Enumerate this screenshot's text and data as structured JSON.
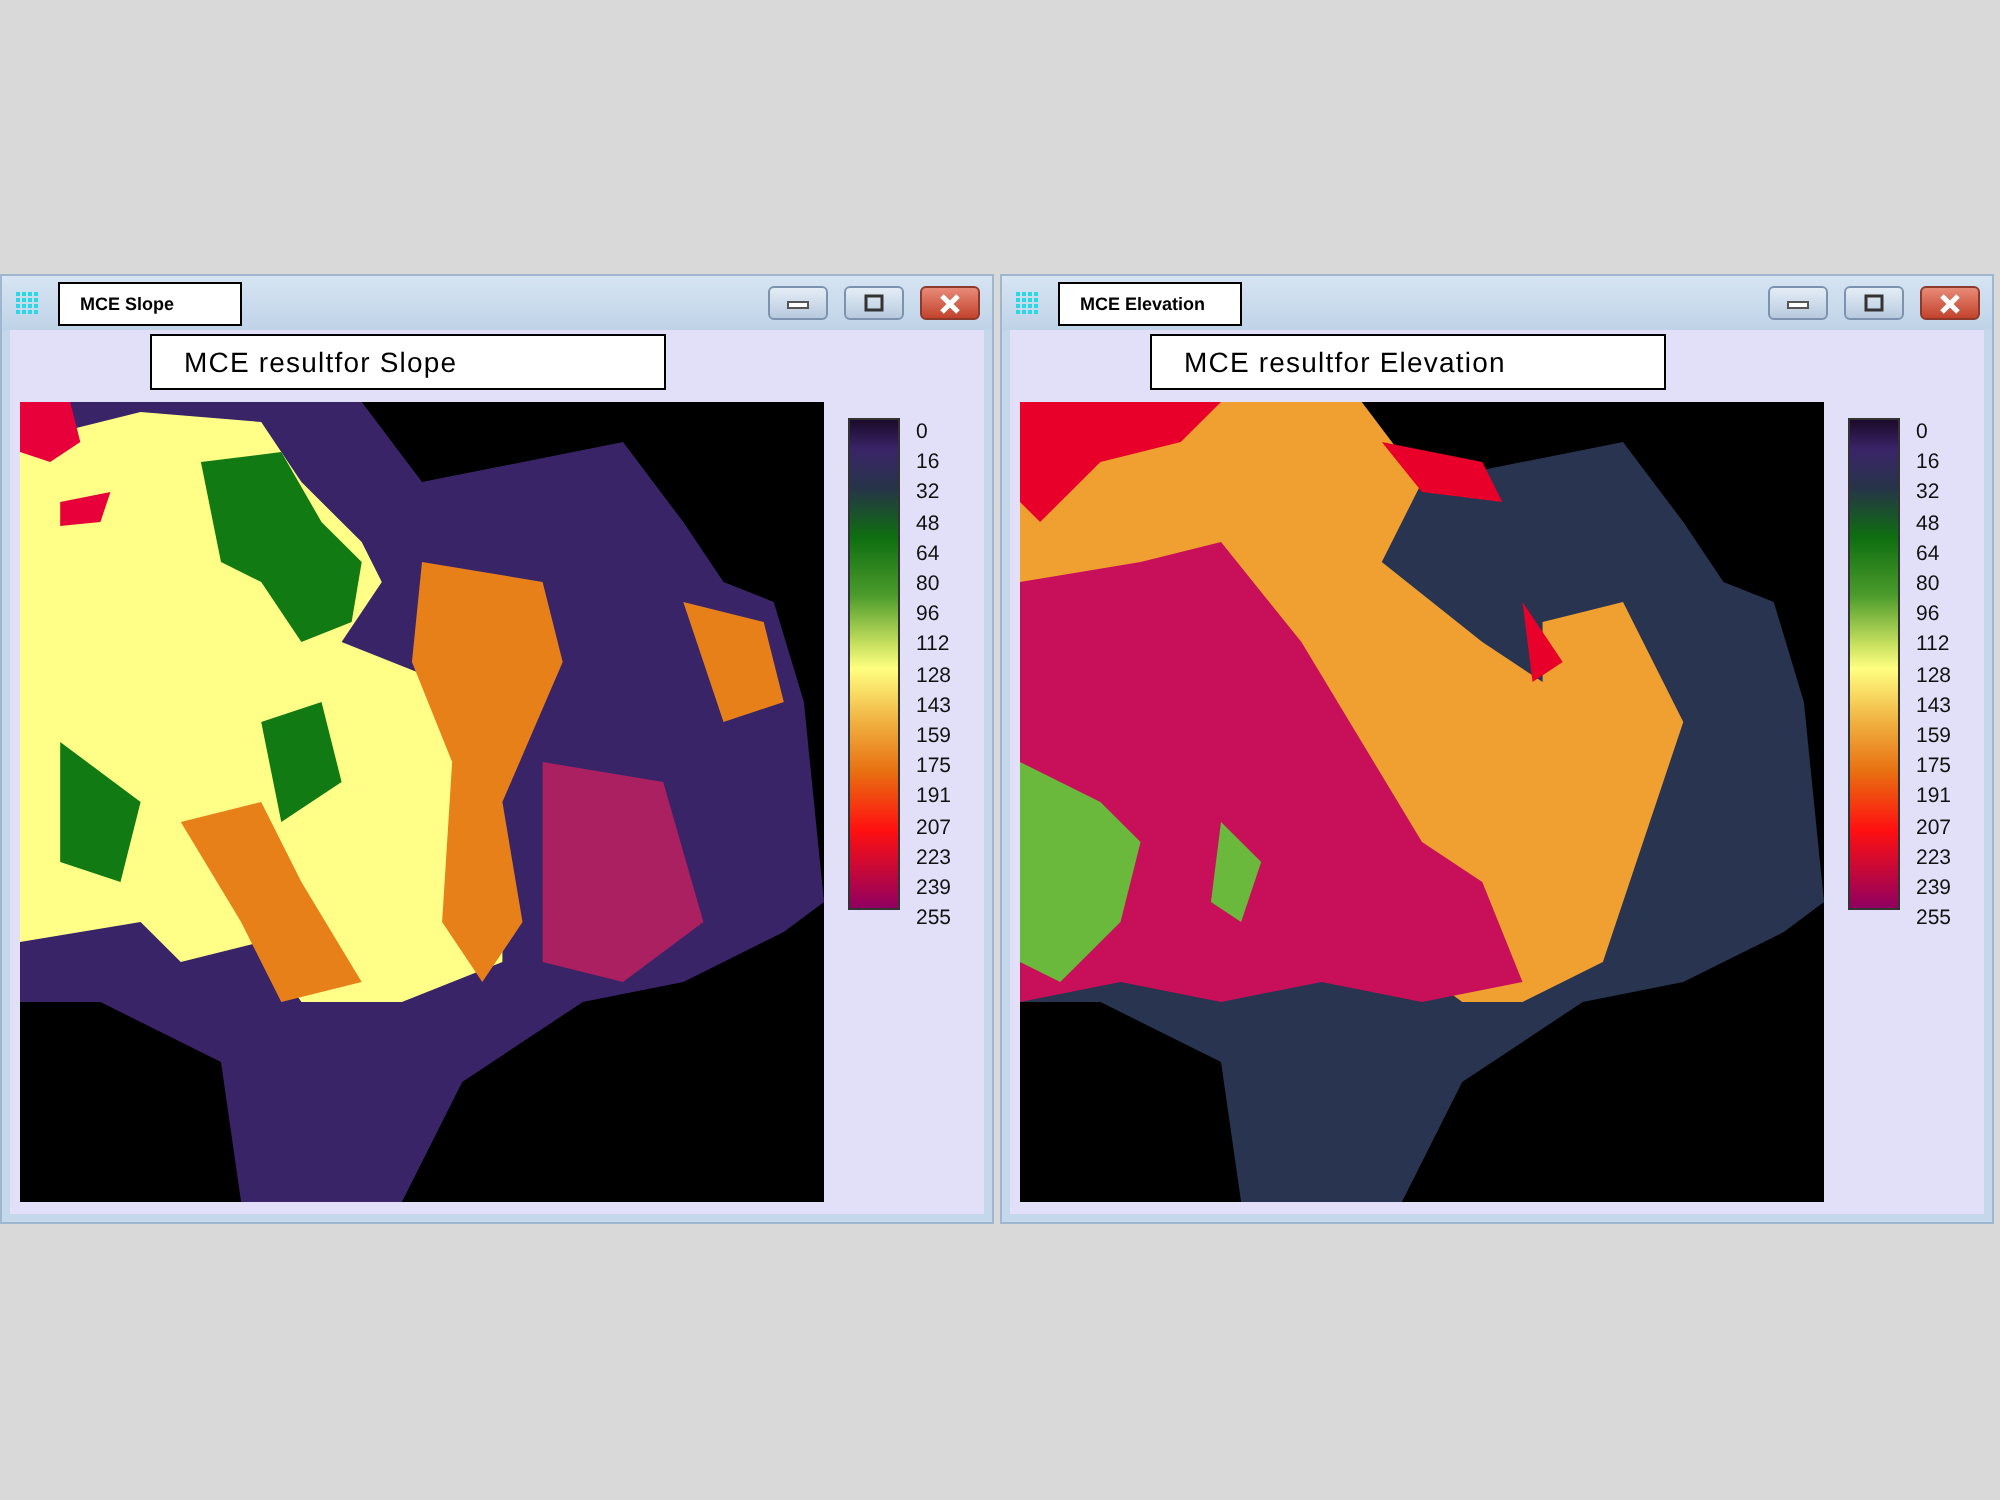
{
  "windows": [
    {
      "title": "MCE  Slope",
      "map_title": "MCE resultfor Slope",
      "kind": "slope",
      "legend_labels": [
        "0",
        "16",
        "32",
        "48",
        "64",
        "80",
        "96",
        "112",
        "128",
        "143",
        "159",
        "175",
        "191",
        "207",
        "223",
        "239",
        "255"
      ]
    },
    {
      "title": "MCE  Elevation",
      "map_title": "MCE resultfor Elevation",
      "kind": "elevation",
      "legend_labels": [
        "0",
        "16",
        "32",
        "48",
        "64",
        "80",
        "96",
        "112",
        "128",
        "143",
        "159",
        "175",
        "191",
        "207",
        "223",
        "239",
        "255"
      ]
    }
  ]
}
